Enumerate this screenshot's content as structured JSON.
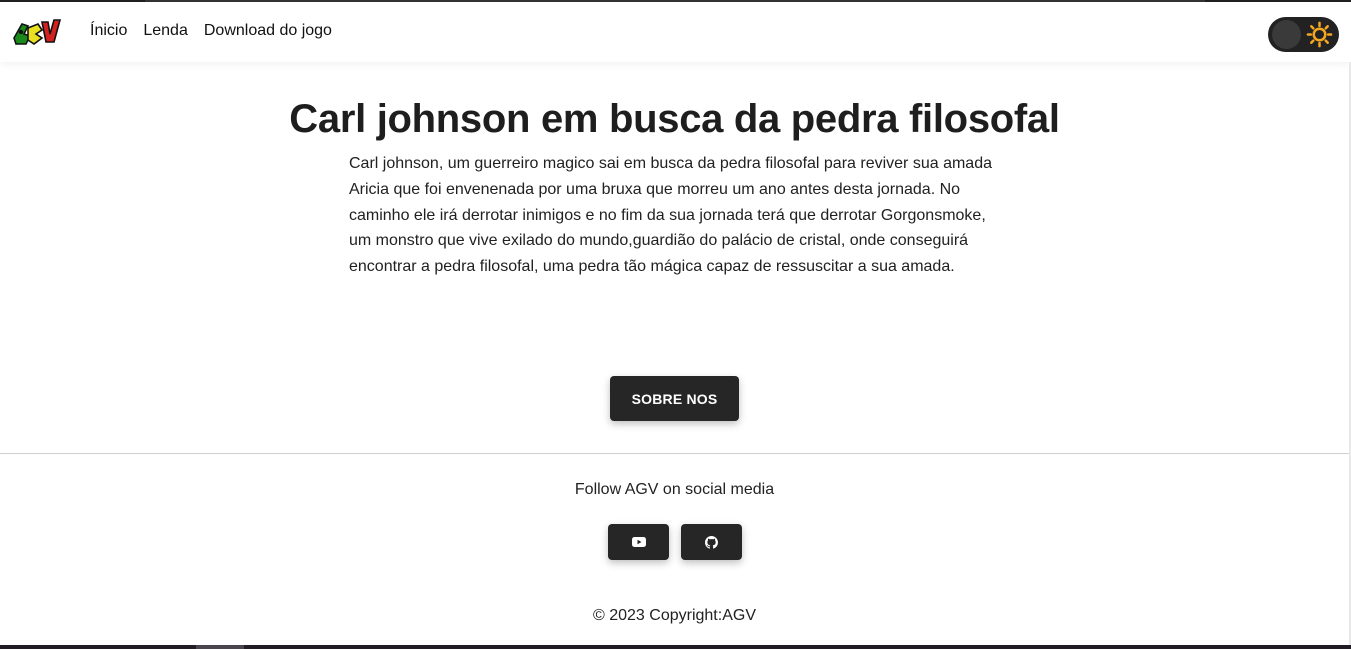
{
  "nav": {
    "logo_text": "AGV",
    "links": [
      "Ínicio",
      "Lenda",
      "Download do jogo"
    ]
  },
  "main": {
    "title": "Carl johnson em busca da pedra filosofal",
    "story": "Carl johnson, um guerreiro magico sai em busca da pedra filosofal para reviver sua amada Aricia que foi envenenada por uma bruxa que morreu um ano antes desta jornada. No caminho ele irá derrotar inimigos e no fim da sua jornada terá que derrotar Gorgonsmoke, um monstro que vive exilado do mundo,guardião do palácio de cristal, onde conseguirá encontrar a pedra filosofal, uma pedra tão mágica capaz de ressuscitar a sua amada.",
    "sobre_button": "SOBRE NOS"
  },
  "footer": {
    "follow_text": "Follow AGV on social media",
    "social": [
      "youtube-icon",
      "github-icon"
    ],
    "copyright": "© 2023 Copyright:AGV"
  },
  "colors": {
    "accent_dark": "#262626",
    "sun": "#f5a623"
  }
}
